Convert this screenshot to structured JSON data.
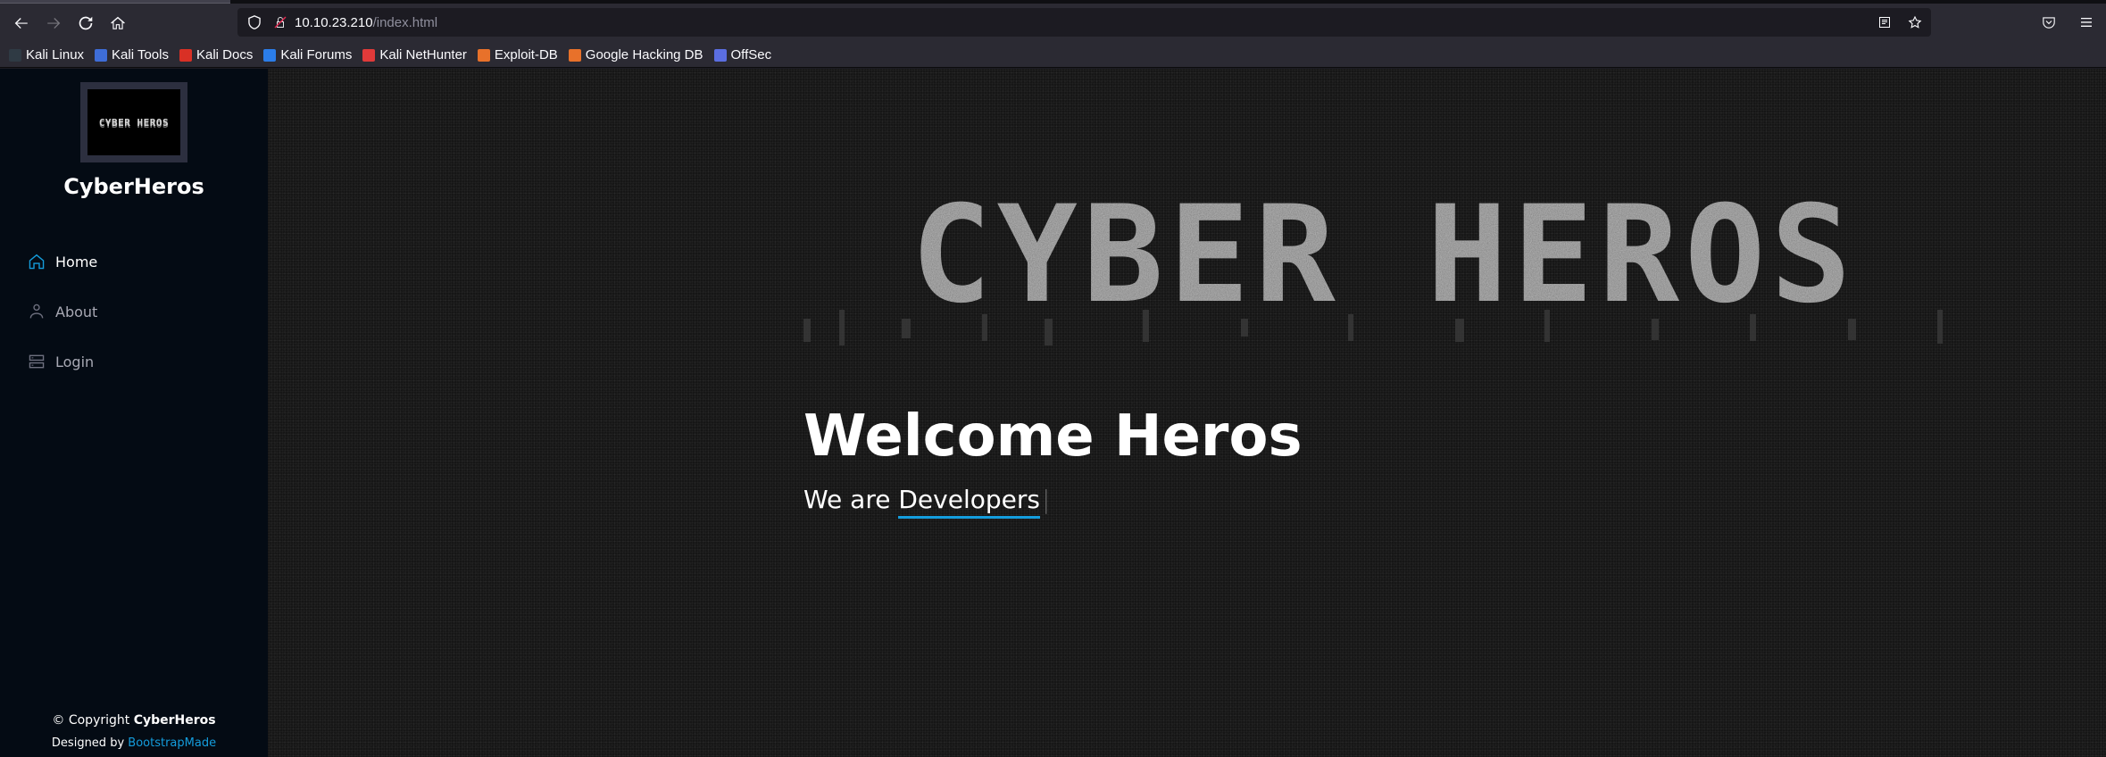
{
  "browser": {
    "url_host": "10.10.23.210",
    "url_path": "/index.html",
    "bookmarks": [
      {
        "label": "Kali Linux",
        "color": "#2f3a44"
      },
      {
        "label": "Kali Tools",
        "color": "#3e6dd8"
      },
      {
        "label": "Kali Docs",
        "color": "#d93025"
      },
      {
        "label": "Kali Forums",
        "color": "#2b7de9"
      },
      {
        "label": "Kali NetHunter",
        "color": "#e03a3a"
      },
      {
        "label": "Exploit-DB",
        "color": "#e8712a"
      },
      {
        "label": "Google Hacking DB",
        "color": "#e8712a"
      },
      {
        "label": "OffSec",
        "color": "#5b6ee1"
      }
    ]
  },
  "sidebar": {
    "logo_text": "CYBER HEROS",
    "site_name": "CyberHeros",
    "nav": [
      {
        "label": "Home",
        "icon": "home-icon",
        "active": true
      },
      {
        "label": "About",
        "icon": "person-icon",
        "active": false
      },
      {
        "label": "Login",
        "icon": "server-icon",
        "active": false
      }
    ],
    "footer": {
      "copyright_prefix": "© Copyright ",
      "copyright_name": "CyberHeros",
      "designed_by": "Designed by ",
      "designer_link": "BootstrapMade"
    }
  },
  "hero": {
    "banner_text": "CYBER HEROS",
    "title": "Welcome Heros",
    "subtitle_prefix": "We are ",
    "subtitle_typed": "Developers",
    "accent_color": "#149ddd"
  }
}
